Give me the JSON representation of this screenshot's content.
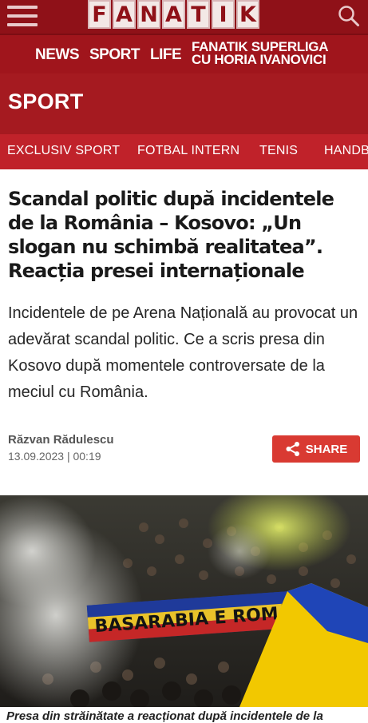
{
  "header": {
    "logo_letters": [
      "F",
      "A",
      "N",
      "A",
      "T",
      "I",
      "K"
    ],
    "menu_icon": "hamburger-icon",
    "search_icon": "search-icon",
    "brand_color": "#8f1118"
  },
  "nav": {
    "items": [
      {
        "label": "NEWS"
      },
      {
        "label": "SPORT"
      },
      {
        "label": "LIFE"
      }
    ],
    "superliga_line1": "FANATIK SUPERLIGA",
    "superliga_line2": "CU HORIA IVANOVICI"
  },
  "section": {
    "title": "SPORT"
  },
  "subnav": {
    "items": [
      {
        "label": "EXCLUSIV SPORT"
      },
      {
        "label": "FOTBAL INTERN"
      },
      {
        "label": "TENIS"
      },
      {
        "label": "HANDBAL"
      }
    ]
  },
  "article": {
    "headline": "Scandal politic după incidentele de la România – Kosovo: „Un slogan nu schimbă realitatea”. Reacția presei internaționale",
    "lead": "Incidentele de pe Arena Națională au provocat un adevărat scandal politic. Ce a scris presa din Kosovo după momentele controversate de la meciul cu România.",
    "author": "Răzvan Rădulescu",
    "date": "13.09.2023 | 00:19",
    "share_label": "SHARE",
    "share_icon": "share-icon",
    "share_color": "#d93a32",
    "image": {
      "banner_text": "BASARABIA E ROMÂNIA"
    },
    "caption": "Presa din străinătate a reacționat după incidentele de la"
  }
}
